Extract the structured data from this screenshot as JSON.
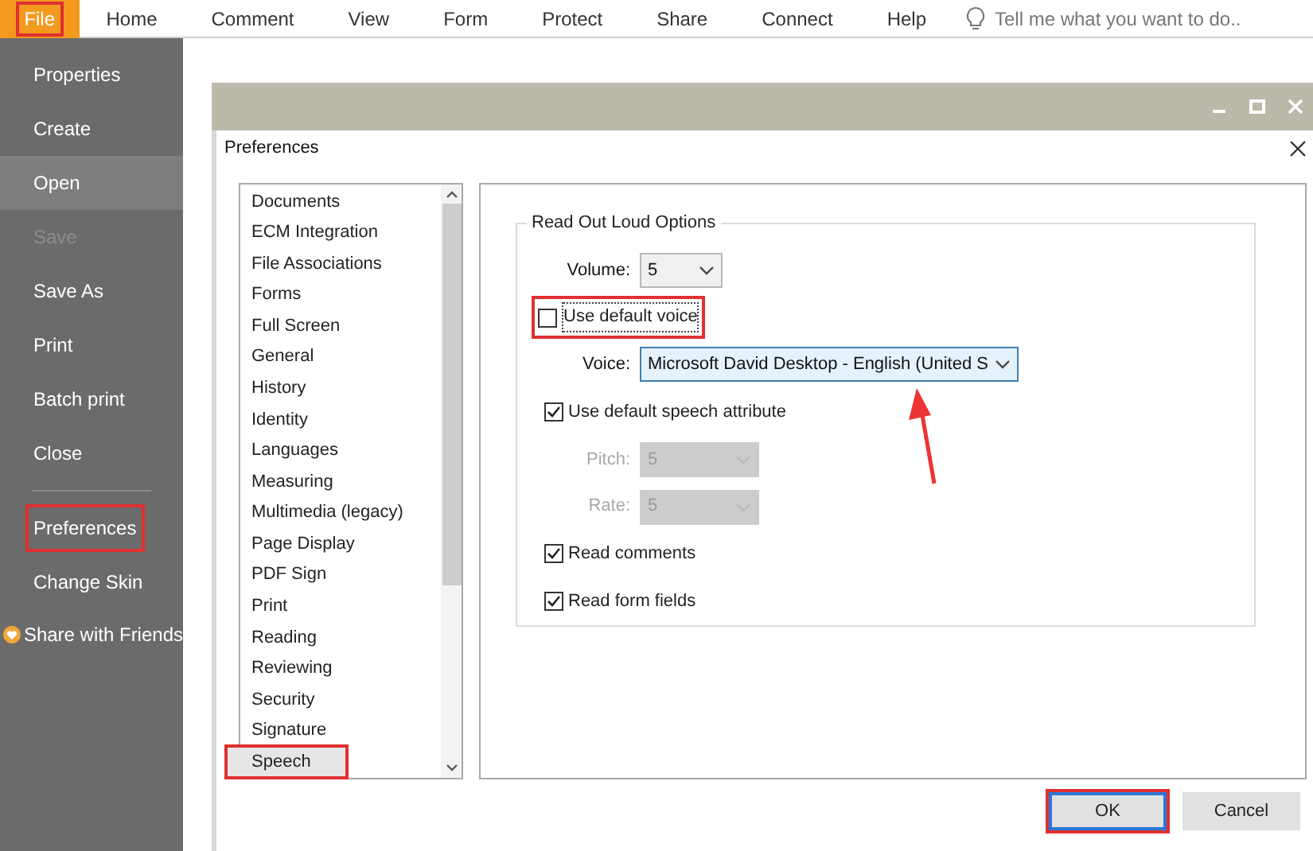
{
  "menu_bar": {
    "tabs": [
      {
        "label": "File",
        "selected": true,
        "highlighted": true
      },
      {
        "label": "Home",
        "selected": false,
        "highlighted": false
      },
      {
        "label": "Comment",
        "selected": false,
        "highlighted": false
      },
      {
        "label": "View",
        "selected": false,
        "highlighted": false
      },
      {
        "label": "Form",
        "selected": false,
        "highlighted": false
      },
      {
        "label": "Protect",
        "selected": false,
        "highlighted": false
      },
      {
        "label": "Share",
        "selected": false,
        "highlighted": false
      },
      {
        "label": "Connect",
        "selected": false,
        "highlighted": false
      },
      {
        "label": "Help",
        "selected": false,
        "highlighted": false
      }
    ],
    "search": {
      "placeholder": "Tell me what you want to do.."
    }
  },
  "sidebar": {
    "items": [
      {
        "kind": "item",
        "label": "Properties",
        "selected": false,
        "disabled": false,
        "highlighted": false
      },
      {
        "kind": "item",
        "label": "Create",
        "selected": false,
        "disabled": false,
        "highlighted": false
      },
      {
        "kind": "item",
        "label": "Open",
        "selected": true,
        "disabled": false,
        "highlighted": false
      },
      {
        "kind": "item",
        "label": "Save",
        "selected": false,
        "disabled": true,
        "highlighted": false
      },
      {
        "kind": "item",
        "label": "Save As",
        "selected": false,
        "disabled": false,
        "highlighted": false
      },
      {
        "kind": "item",
        "label": "Print",
        "selected": false,
        "disabled": false,
        "highlighted": false
      },
      {
        "kind": "item",
        "label": "Batch print",
        "selected": false,
        "disabled": false,
        "highlighted": false
      },
      {
        "kind": "item",
        "label": "Close",
        "selected": false,
        "disabled": false,
        "highlighted": false
      },
      {
        "kind": "divider"
      },
      {
        "kind": "item",
        "label": "Preferences",
        "selected": false,
        "disabled": false,
        "highlighted": true
      },
      {
        "kind": "item",
        "label": "Change Skin",
        "selected": false,
        "disabled": false,
        "highlighted": false
      },
      {
        "kind": "share",
        "label": "Share with Friends",
        "selected": false,
        "disabled": false,
        "highlighted": false
      }
    ]
  },
  "dialog": {
    "title": "Preferences",
    "categories": [
      {
        "label": "Documents",
        "selected": false,
        "highlighted": false
      },
      {
        "label": "ECM Integration",
        "selected": false,
        "highlighted": false
      },
      {
        "label": "File Associations",
        "selected": false,
        "highlighted": false
      },
      {
        "label": "Forms",
        "selected": false,
        "highlighted": false
      },
      {
        "label": "Full Screen",
        "selected": false,
        "highlighted": false
      },
      {
        "label": "General",
        "selected": false,
        "highlighted": false
      },
      {
        "label": "History",
        "selected": false,
        "highlighted": false
      },
      {
        "label": "Identity",
        "selected": false,
        "highlighted": false
      },
      {
        "label": "Languages",
        "selected": false,
        "highlighted": false
      },
      {
        "label": "Measuring",
        "selected": false,
        "highlighted": false
      },
      {
        "label": "Multimedia (legacy)",
        "selected": false,
        "highlighted": false
      },
      {
        "label": "Page Display",
        "selected": false,
        "highlighted": false
      },
      {
        "label": "PDF Sign",
        "selected": false,
        "highlighted": false
      },
      {
        "label": "Print",
        "selected": false,
        "highlighted": false
      },
      {
        "label": "Reading",
        "selected": false,
        "highlighted": false
      },
      {
        "label": "Reviewing",
        "selected": false,
        "highlighted": false
      },
      {
        "label": "Security",
        "selected": false,
        "highlighted": false
      },
      {
        "label": "Signature",
        "selected": false,
        "highlighted": false
      },
      {
        "label": "Speech",
        "selected": true,
        "highlighted": true
      }
    ],
    "group": {
      "title": "Read Out Loud Options",
      "rows": [
        {
          "kind": "select",
          "label": "Volume:",
          "value": "5",
          "disabled": false,
          "focused": false
        },
        {
          "kind": "checkbox",
          "label": "Use default voice",
          "checked": false,
          "highlighted": true
        },
        {
          "kind": "select",
          "label": "Voice:",
          "value": "Microsoft David Desktop - English (United S",
          "disabled": false,
          "focused": true
        },
        {
          "kind": "checkbox",
          "label": "Use default speech attribute",
          "checked": true,
          "highlighted": false
        },
        {
          "kind": "select",
          "label": "Pitch:",
          "value": "5",
          "disabled": true,
          "focused": false
        },
        {
          "kind": "select",
          "label": "Rate:",
          "value": "5",
          "disabled": true,
          "focused": false
        },
        {
          "kind": "checkbox",
          "label": "Read comments",
          "checked": true,
          "highlighted": false
        },
        {
          "kind": "checkbox",
          "label": "Read form fields",
          "checked": true,
          "highlighted": false
        }
      ]
    },
    "buttons": [
      {
        "label": "OK",
        "default": true,
        "highlighted": true
      },
      {
        "label": "Cancel",
        "default": false,
        "highlighted": false
      }
    ]
  }
}
